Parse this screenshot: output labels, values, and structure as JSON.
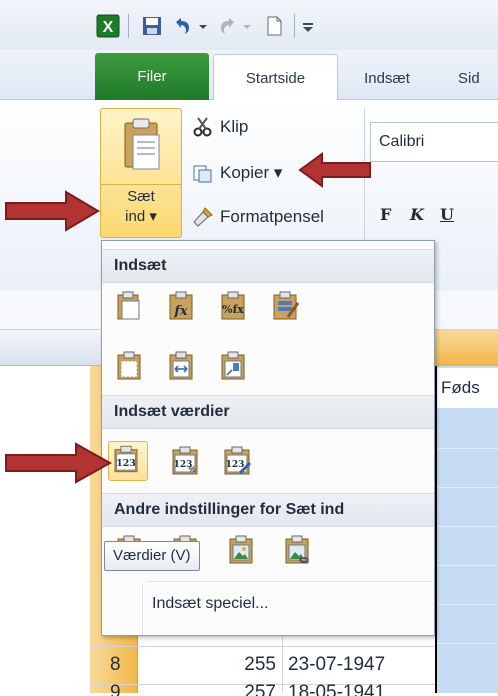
{
  "app": {
    "quick_access": [
      "excel-logo",
      "save",
      "undo",
      "redo",
      "new-document",
      "customize"
    ]
  },
  "tabs": {
    "file": "Filer",
    "home": "Startside",
    "insert": "Indsæt",
    "page": "Sid"
  },
  "clipboard": {
    "paste_label_line1": "Sæt",
    "paste_label_line2": "ind ▾",
    "cut": "Klip",
    "copy": "Kopier ▾",
    "format_painter": "Formatpensel"
  },
  "font": {
    "name": "Calibri",
    "bold": "F",
    "italic": "K",
    "underline": "U"
  },
  "paste_menu": {
    "section_paste": "Indsæt",
    "section_values": "Indsæt værdier",
    "section_other": "Andre indstillinger for Sæt ind",
    "paste_special": "Indsæt speciel...",
    "tooltip": "Værdier (V)",
    "value_icon_text": "123"
  },
  "sheet": {
    "header_cell": "Føds",
    "rows": [
      {
        "row": "8",
        "id": "255",
        "date": "23-07-1947"
      },
      {
        "row": "9",
        "id": "257",
        "date": "18-05-1941"
      }
    ]
  },
  "colors": {
    "file_tab": "#2a8a34",
    "arrow": "#a52a2a",
    "selection": "#c6dcf5",
    "highlight": "#fbd870"
  }
}
